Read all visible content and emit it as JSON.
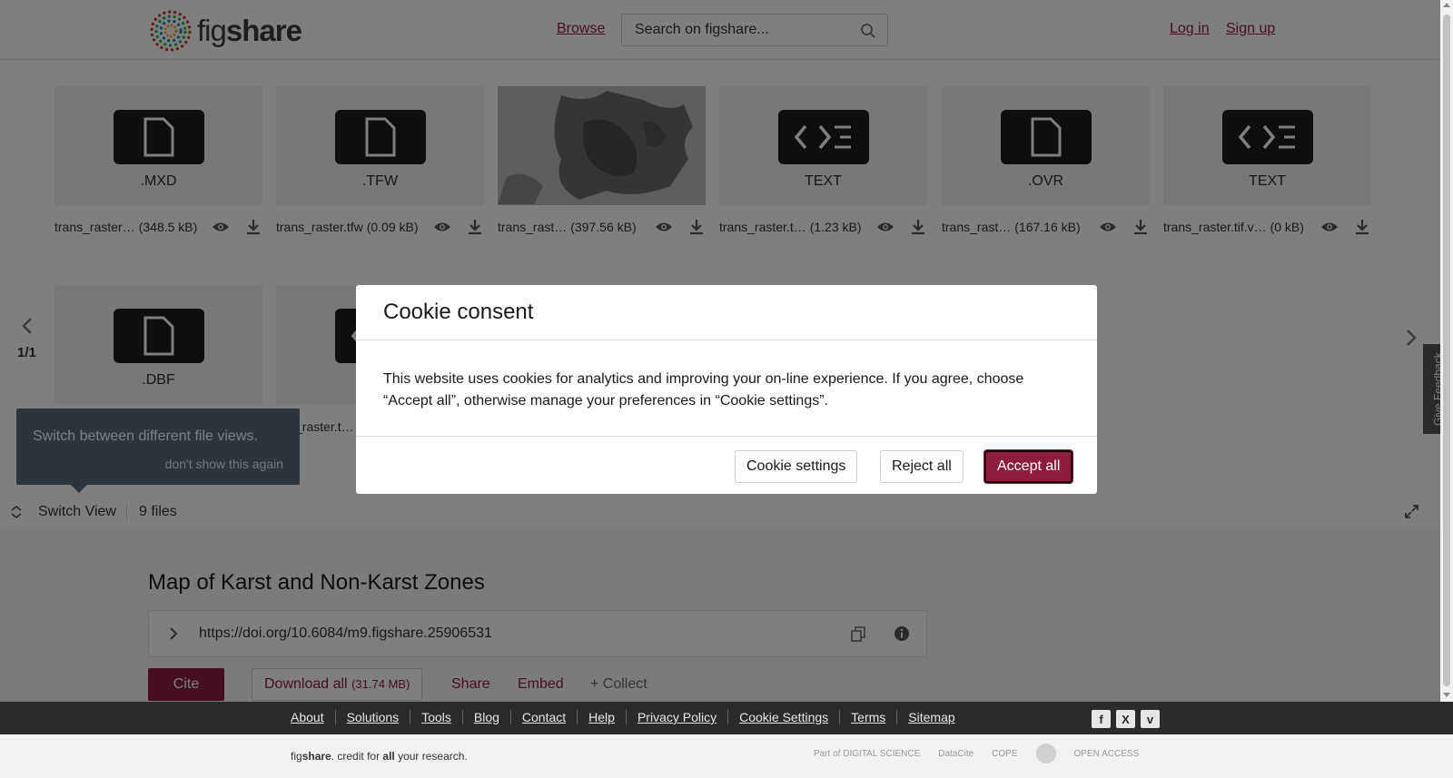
{
  "header": {
    "logo_prefix": "fig",
    "logo_suffix": "share",
    "browse": "Browse",
    "search_placeholder": "Search on figshare...",
    "login": "Log in",
    "signup": "Sign up"
  },
  "viewer": {
    "page": "1/1",
    "files": [
      {
        "ext": ".MXD",
        "name": "trans_raster…",
        "size": "(348.5 kB)",
        "icon": "file-icon"
      },
      {
        "ext": ".TFW",
        "name": "trans_raster.tfw",
        "size": "(0.09 kB)",
        "icon": "file-icon"
      },
      {
        "ext": "",
        "name": "trans_rast…",
        "size": "(397.56 kB)",
        "icon": "map-thumbnail"
      },
      {
        "ext": "TEXT",
        "name": "trans_raster.t…",
        "size": "(1.23 kB)",
        "icon": "code-icon"
      },
      {
        "ext": ".OVR",
        "name": "trans_rast…",
        "size": "(167.16 kB)",
        "icon": "file-icon"
      },
      {
        "ext": "TEXT",
        "name": "trans_raster.tif.v…",
        "size": "(0 kB)",
        "icon": "code-icon"
      },
      {
        "ext": ".DBF",
        "name": "",
        "size": "",
        "icon": "file-icon"
      },
      {
        "ext": "",
        "name": "s_raster.t…",
        "size": "",
        "icon": "code-icon"
      }
    ],
    "tooltip": {
      "text": "Switch between different file views.",
      "dismiss": "don't show this again"
    },
    "toolbar": {
      "switch_view": "Switch View",
      "file_count": "9 files"
    }
  },
  "item": {
    "title": "Map of Karst and Non-Karst Zones",
    "doi": "https://doi.org/10.6084/m9.figshare.25906531",
    "cite": "Cite",
    "download_all": "Download all",
    "download_size": "(31.74 MB)",
    "share": "Share",
    "embed": "Embed",
    "collect": "+ Collect"
  },
  "footer": {
    "links": [
      "About",
      "Solutions",
      "Tools",
      "Blog",
      "Contact",
      "Help",
      "Privacy Policy",
      "Cookie Settings",
      "Terms",
      "Sitemap"
    ],
    "tagline_fig": "fig",
    "tagline_share": "share",
    "tagline_mid": ". credit for ",
    "tagline_all": "all",
    "tagline_end": " your research.",
    "partners": [
      "Part of DIGITAL SCIENCE",
      "DataCite",
      "COPE",
      "",
      "OPEN ACCESS"
    ]
  },
  "feedback": "Give Feedback",
  "cookie_modal": {
    "title": "Cookie consent",
    "body": "This website uses cookies for analytics and improving your on-line experience. If you agree, choose “Accept all”, otherwise manage your preferences in “Cookie settings”.",
    "settings": "Cookie settings",
    "reject": "Reject all",
    "accept": "Accept all"
  },
  "colors": {
    "brand": "#8c1d3c",
    "overlay": "rgba(0,0,0,0.5)",
    "footer_bg": "#2b2b2b"
  }
}
